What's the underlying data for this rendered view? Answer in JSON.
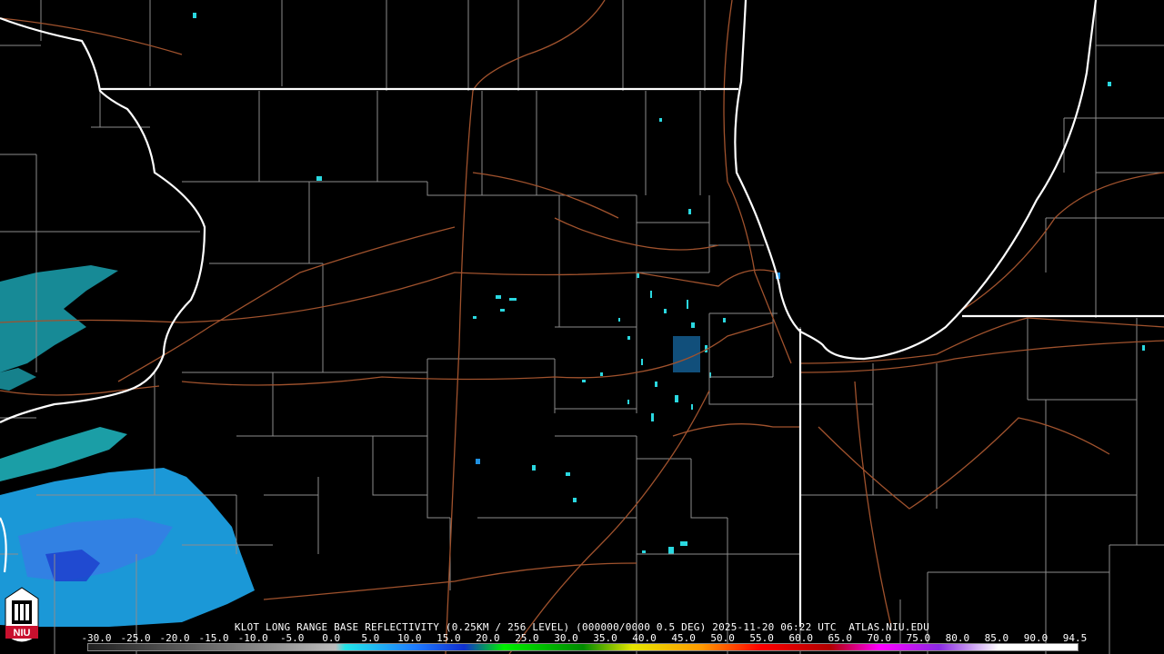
{
  "title": "KLOT LONG RANGE BASE REFLECTIVITY (0.25KM / 256 LEVEL) (000000/0000 0.5 DEG) 2025-11-20 06:22 UTC  ATLAS.NIU.EDU",
  "scale": {
    "labels": [
      "-30.0",
      "-25.0",
      "-20.0",
      "-15.0",
      "-10.0",
      "-5.0",
      "0.0",
      "5.0",
      "10.0",
      "15.0",
      "20.0",
      "25.0",
      "30.0",
      "35.0",
      "40.0",
      "45.0",
      "50.0",
      "55.0",
      "60.0",
      "65.0",
      "70.0",
      "75.0",
      "80.0",
      "85.0",
      "90.0",
      "94.5"
    ],
    "min": -30,
    "max": 94.5
  },
  "logo": {
    "text": "NIU"
  },
  "colors": {
    "background": "#000000",
    "state_lines": "#ffffff",
    "county_lines": "#8c8c8c",
    "highways": "#a0522d",
    "echo_light": "#2ad8e0",
    "echo_mid": "#1fa0ff",
    "echo_strong": "#1c3ccc",
    "logo_red": "#c8102e"
  }
}
